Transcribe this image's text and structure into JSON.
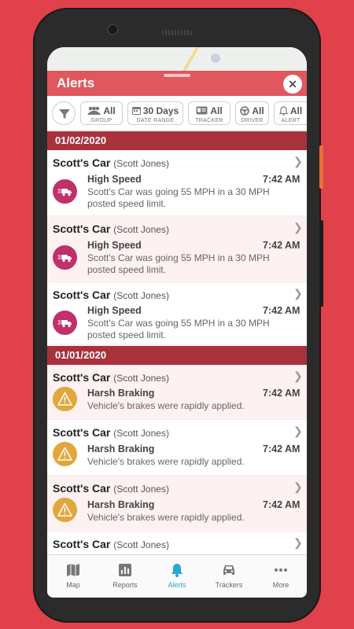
{
  "header": {
    "title": "Alerts",
    "close_glyph": "✕"
  },
  "filters": [
    {
      "value": "All",
      "label": "GROUP",
      "icon": "group-icon"
    },
    {
      "value": "30 Days",
      "label": "DATE RANGE",
      "icon": "calendar-icon"
    },
    {
      "value": "All",
      "label": "TRACKER",
      "icon": "id-card-icon"
    },
    {
      "value": "All",
      "label": "DRIVER",
      "icon": "steering-wheel-icon"
    },
    {
      "value": "All",
      "label": "ALERT",
      "icon": "bell-icon"
    }
  ],
  "groups": [
    {
      "date": "01/02/2020",
      "alerts": [
        {
          "vehicle": "Scott's Car",
          "driver": "(Scott Jones)",
          "type": "High Speed",
          "time": "7:42 AM",
          "desc": "Scott's Car was going 55 MPH in a 30 MPH posted speed limit."
        },
        {
          "vehicle": "Scott's Car",
          "driver": "(Scott Jones)",
          "type": "High Speed",
          "time": "7:42 AM",
          "desc": "Scott's Car was going 55 MPH in a 30 MPH posted speed limit."
        },
        {
          "vehicle": "Scott's Car",
          "driver": "(Scott Jones)",
          "type": "High Speed",
          "time": "7:42 AM",
          "desc": "Scott's Car was going 55 MPH in a 30 MPH posted speed limit."
        }
      ]
    },
    {
      "date": "01/01/2020",
      "alerts": [
        {
          "vehicle": "Scott's Car",
          "driver": "(Scott Jones)",
          "type": "Harsh Braking",
          "time": "7:42 AM",
          "desc": "Vehicle's brakes were rapidly applied."
        },
        {
          "vehicle": "Scott's Car",
          "driver": "(Scott Jones)",
          "type": "Harsh Braking",
          "time": "7:42 AM",
          "desc": "Vehicle's brakes were rapidly applied."
        },
        {
          "vehicle": "Scott's Car",
          "driver": "(Scott Jones)",
          "type": "Harsh Braking",
          "time": "7:42 AM",
          "desc": "Vehicle's brakes were rapidly applied."
        },
        {
          "vehicle": "Scott's Car",
          "driver": "(Scott Jones)"
        }
      ]
    }
  ],
  "nav": [
    {
      "label": "Map",
      "icon": "map-icon"
    },
    {
      "label": "Reports",
      "icon": "reports-icon"
    },
    {
      "label": "Alerts",
      "icon": "bell-icon",
      "active": true
    },
    {
      "label": "Trackers",
      "icon": "car-icon"
    },
    {
      "label": "More",
      "icon": "more-icon"
    }
  ],
  "colors": {
    "background": "#e0414a",
    "header": "#e0575e",
    "date_bar": "#a8313d",
    "speed_badge": "#c0306b",
    "brake_badge": "#e2a63a",
    "nav_active": "#2aa6d6"
  }
}
